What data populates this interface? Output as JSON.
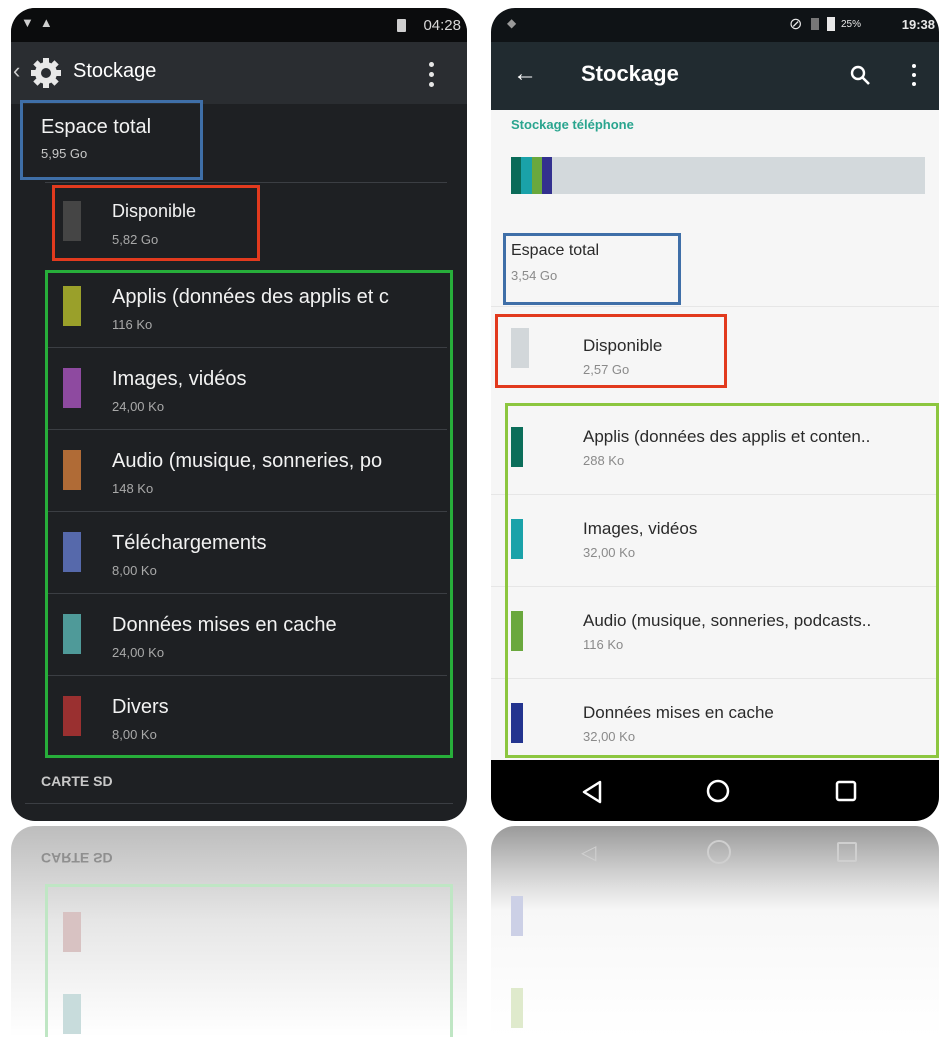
{
  "left_phone": {
    "status": {
      "time": "04:28"
    },
    "header": {
      "title": "Stockage"
    },
    "total": {
      "label": "Espace total",
      "value": "5,95 Go"
    },
    "available": {
      "label": "Disponible",
      "value": "5,82 Go",
      "color": "#454545"
    },
    "items": [
      {
        "label": "Applis (données des applis et c",
        "value": "116 Ko",
        "color": "#9aa02a"
      },
      {
        "label": "Images, vidéos",
        "value": "24,00 Ko",
        "color": "#8e4aa0"
      },
      {
        "label": "Audio (musique, sonneries, po",
        "value": "148 Ko",
        "color": "#b06b36"
      },
      {
        "label": "Téléchargements",
        "value": "8,00 Ko",
        "color": "#5669ab"
      },
      {
        "label": "Données mises en cache",
        "value": "24,00 Ko",
        "color": "#4f9a99"
      },
      {
        "label": "Divers",
        "value": "8,00 Ko",
        "color": "#9a3030"
      }
    ],
    "section": "CARTE SD"
  },
  "right_phone": {
    "status": {
      "battery": "25%",
      "time": "19:38"
    },
    "header": {
      "title": "Stockage"
    },
    "section": "Stockage téléphone",
    "usage_bar": {
      "colors": [
        "#0a6b58",
        "#1aa2a9",
        "#6aa83d",
        "#33318f"
      ],
      "used_fraction": 0.1,
      "track_color": "#d3d9dc"
    },
    "total": {
      "label": "Espace total",
      "value": "3,54 Go"
    },
    "available": {
      "label": "Disponible",
      "value": "2,57 Go",
      "color": "#d2d7da"
    },
    "items": [
      {
        "label": "Applis (données des applis et conten..",
        "value": "288 Ko",
        "color": "#0b6e5a"
      },
      {
        "label": "Images, vidéos",
        "value": "32,00 Ko",
        "color": "#1aa2a9"
      },
      {
        "label": "Audio (musique, sonneries, podcasts..",
        "value": "116 Ko",
        "color": "#6aa83d"
      },
      {
        "label": "Données mises en cache",
        "value": "32,00 Ko",
        "color": "#23348f"
      }
    ]
  },
  "highlight_colors": {
    "total": "#3f6fa8",
    "available": "#e23a1e",
    "left_items": "#27ae3a",
    "right_items": "#8cc63f"
  }
}
